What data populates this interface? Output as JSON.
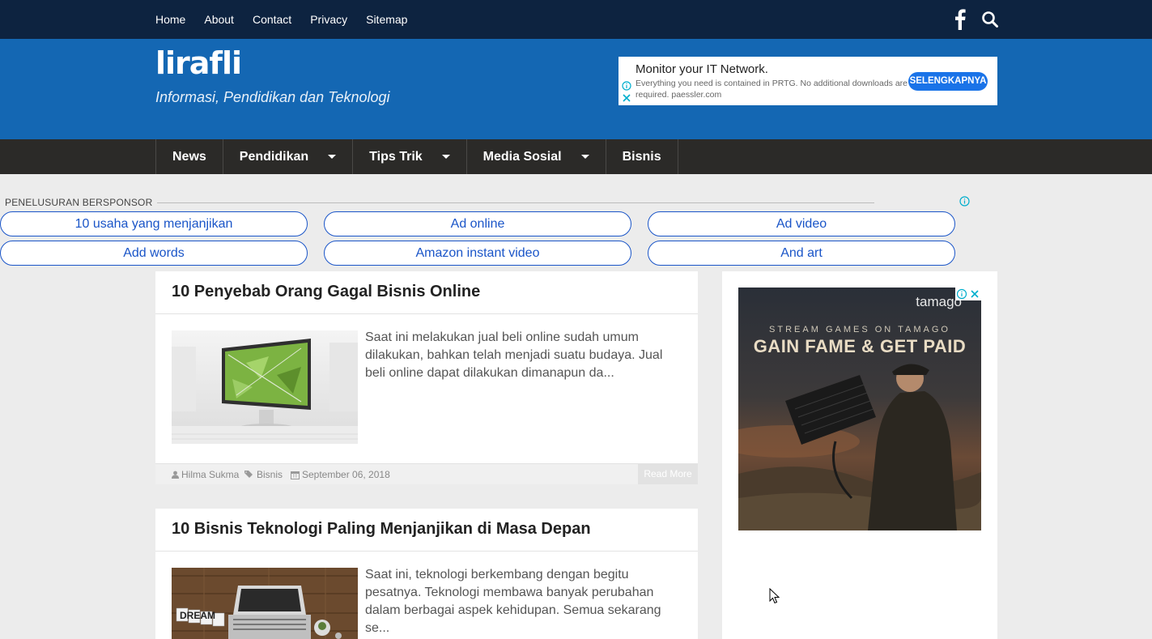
{
  "topnav": {
    "links": [
      "Home",
      "About",
      "Contact",
      "Privacy",
      "Sitemap"
    ],
    "icons": [
      "facebook-icon",
      "search-icon"
    ]
  },
  "header": {
    "title": "lirafli",
    "tagline": "Informasi, Pendidikan dan Teknologi",
    "ad": {
      "title": "Monitor your IT Network.",
      "description": "Everything you need is contained in PRTG. No additional downloads are required. paessler.com",
      "cta": "SELENGKAPNYA"
    }
  },
  "mainnav": {
    "items": [
      {
        "label": "News",
        "dropdown": false
      },
      {
        "label": "Pendidikan",
        "dropdown": true
      },
      {
        "label": "Tips Trik",
        "dropdown": true
      },
      {
        "label": "Media Sosial",
        "dropdown": true
      },
      {
        "label": "Bisnis",
        "dropdown": false
      }
    ]
  },
  "sponsored": {
    "label": "PENELUSURAN BERSPONSOR",
    "links": [
      "10 usaha yang menjanjikan",
      "Ad online",
      "Ad video",
      "Add words",
      "Amazon instant video",
      "And art"
    ]
  },
  "posts": [
    {
      "title": "10 Penyebab Orang Gagal Bisnis Online",
      "excerpt": "Saat ini melakukan jual beli online sudah umum dilakukan, bahkan telah menjadi suatu budaya. Jual beli online dapat dilakukan dimanapun da...",
      "author": "Hilma Sukma",
      "category": "Bisnis",
      "date": "September 06, 2018",
      "read_more": "Read More"
    },
    {
      "title": "10 Bisnis Teknologi Paling Menjanjikan di Masa Depan",
      "excerpt": "Saat ini, teknologi berkembang dengan begitu pesatnya. Teknologi membawa banyak perubahan dalam berbagai aspek kehidupan. Semua sekarang se...",
      "thumb_text": "DREAM"
    }
  ],
  "sidebar_ad": {
    "brand": "tamago",
    "subheading": "STREAM GAMES ON TAMAGO",
    "headline": "GAIN FAME & GET PAID"
  },
  "colors": {
    "topbar": "#0d2340",
    "header": "#1467b3",
    "mainnav": "#2b2a28",
    "link": "#1a55c8",
    "cta": "#1a73e8"
  }
}
